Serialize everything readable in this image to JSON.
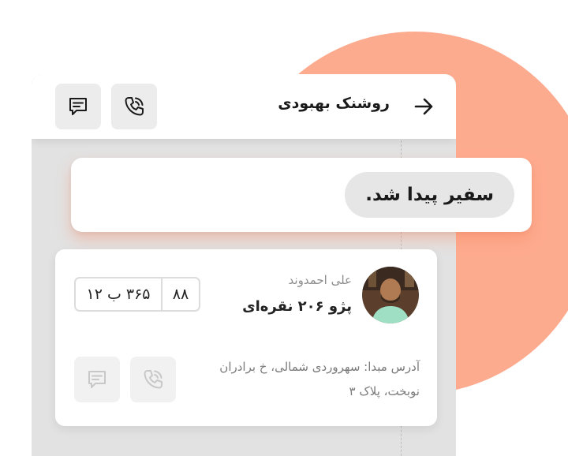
{
  "colors": {
    "accent": "#fdab8f",
    "background_panel": "#e2e2e2",
    "button_bg": "#ececec",
    "disabled_icon": "#c8c8c8"
  },
  "header": {
    "contact_name": "روشنک بهبودی",
    "back_icon": "arrow-right-icon",
    "call_icon": "phone-icon",
    "message_icon": "message-icon"
  },
  "banner": {
    "message": "سفیر پیدا شد."
  },
  "driver_card": {
    "driver_name": "علی احمدوند",
    "car_model": "پژو ۲۰۶ نقره‌ای",
    "plate": {
      "main": "۳۶۵ ب ۱۲",
      "region_code": "۸۸"
    },
    "address_line1": "آدرس مبدا: سهروردی شمالی، خ برادران",
    "address_line2": "نوبخت، پلاک ۳",
    "call_icon": "phone-icon",
    "message_icon": "message-icon"
  }
}
